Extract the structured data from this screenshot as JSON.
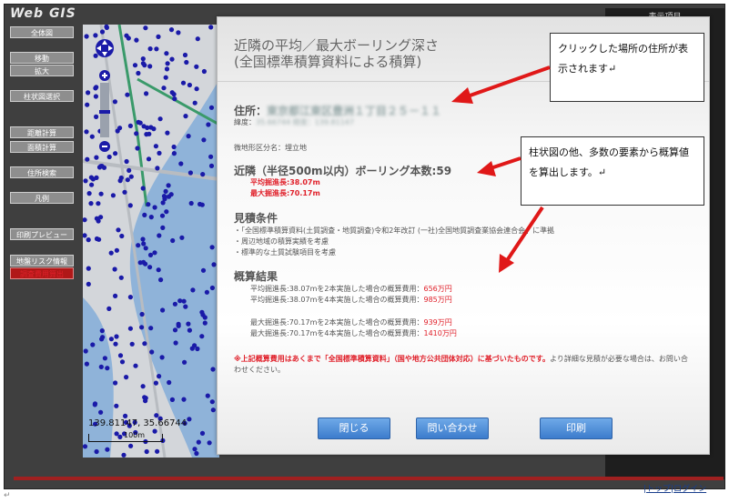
{
  "app": {
    "logo": "Web GIS"
  },
  "sidebar": {
    "items": [
      {
        "label": "全体図"
      },
      {
        "label": "移動"
      },
      {
        "label": "拡大"
      },
      {
        "label": "柱状図選択"
      },
      {
        "label": "距離計算"
      },
      {
        "label": "面積計算"
      },
      {
        "label": "住所検索"
      },
      {
        "label": "凡例"
      },
      {
        "label": "印刷プレビュー"
      },
      {
        "label": "地盤リスク情報"
      },
      {
        "label": "調査費用算出"
      }
    ]
  },
  "map": {
    "coords": "139.81147, 35.66744",
    "scale_label": "100m"
  },
  "right_panel": {
    "title": "表示項目"
  },
  "footer": {
    "link_top": "トップ",
    "link_login": "ログイン",
    "sep": "|"
  },
  "modal": {
    "title_line1": "近隣の平均／最大ボーリング深さ",
    "title_line2": "(全国標準積算資料による積算)",
    "address_label": "住所：",
    "address_value": "東京都江東区豊洲１丁目２５－１１",
    "latlon_label": "緯度：",
    "latlon_value": "35.66744 経度：139.81147",
    "landform": "微地形区分名：埋立地",
    "nearby_heading": "近隣（半径500m以内）ボーリング本数:59",
    "avg_depth": "平均掘進長:38.07m",
    "max_depth": "最大掘進長:70.17m",
    "conditions_heading": "見積条件",
    "conditions": [
      "・「全国標準積算資料(土質調査・地質調査)令和2年改訂 (一社)全国地質調査業協会連合会」に準拠",
      "・周辺地域の積算実績を考慮",
      "・標準的な土質試験項目を考慮"
    ],
    "results_heading": "概算結果",
    "results": [
      {
        "text": "平均掘進長:38.07mを2本実施した場合の概算費用：",
        "value": "656万円"
      },
      {
        "text": "平均掘進長:38.07mを4本実施した場合の概算費用：",
        "value": "985万円"
      },
      {
        "text": "最大掘進長:70.17mを2本実施した場合の概算費用：",
        "value": "939万円"
      },
      {
        "text": "最大掘進長:70.17mを4本実施した場合の概算費用：",
        "value": "1410万円"
      }
    ],
    "note_red": "※上記概算費用はあくまで「全国標準積算資料」（国や地方公共団体対応）に基づいたものです。",
    "note_rest": "より詳細な見積が必要な場合は、お問い合わせください。",
    "buttons": {
      "close": "閉じる",
      "inquiry": "問い合わせ",
      "print": "印刷"
    }
  },
  "callouts": {
    "top": "クリックした場所の住所が表示されます↵",
    "middle": "柱状図の他、多数の要素から概算値を算出します。↵"
  },
  "page_mark": "↵",
  "colors": {
    "accent_blue": "#3c7ccc",
    "alert_red": "#e0202a",
    "sidebar_active": "#b01818",
    "dot_blue": "#1a1aa8"
  }
}
